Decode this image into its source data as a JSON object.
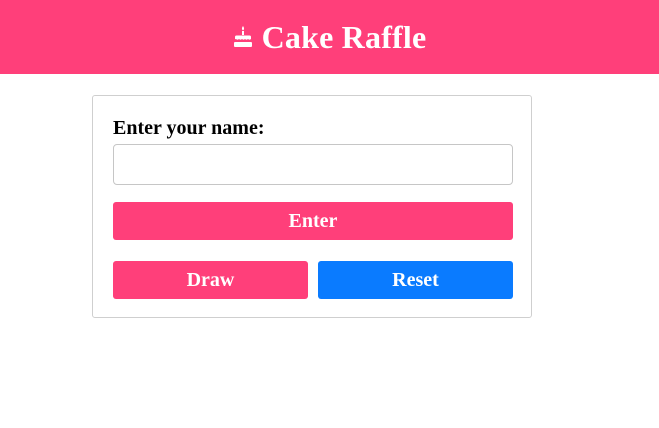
{
  "header": {
    "icon": "cake-icon",
    "title": "Cake Raffle"
  },
  "form": {
    "name_label": "Enter your name:",
    "name_value": "",
    "name_placeholder": "",
    "enter_label": "Enter",
    "draw_label": "Draw",
    "reset_label": "Reset"
  },
  "colors": {
    "brand": "#ff3f7a",
    "reset": "#0a7bff"
  }
}
